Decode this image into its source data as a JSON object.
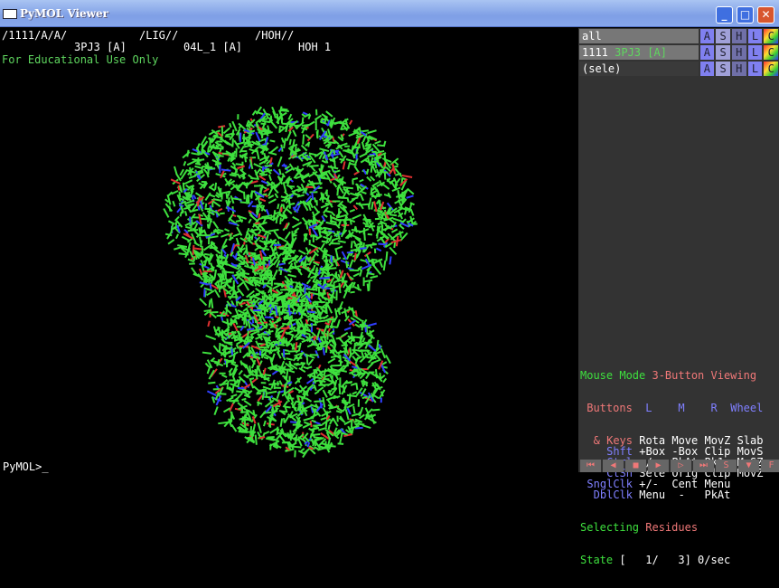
{
  "window": {
    "title": "PyMOL Viewer",
    "minimize": "_",
    "maximize": "□",
    "close": "✕"
  },
  "viewer": {
    "path1": "/1111/A/A/",
    "path2": "/LIG//",
    "path3": "/HOH//",
    "sel1": "3PJ3 [A]",
    "sel2": "04L_1 [A]",
    "sel3": "HOH 1",
    "notice": "For Educational Use Only",
    "command_prompt": "PyMOL>_"
  },
  "objects": [
    {
      "name": "all",
      "extra": ""
    },
    {
      "name": "1111 ",
      "extra": "3PJ3 [A]"
    },
    {
      "name": "(sele)",
      "extra": ""
    }
  ],
  "object_buttons": [
    "A",
    "S",
    "H",
    "L",
    "C"
  ],
  "mouse": {
    "mode_label": "Mouse Mode ",
    "mode_value": "3-Button Viewing",
    "buttons": "Buttons",
    "L": "L",
    "M": "M",
    "R": "R",
    "wheel": "Wheel",
    "rows": [
      {
        "key": "& Keys",
        "vals": "Rota Move MovZ Slab"
      },
      {
        "key": "Shft",
        "vals": "+Box -Box Clip MovS"
      },
      {
        "key": "Ctrl",
        "vals": "+/-  PkAt Pk1  MvSZ"
      },
      {
        "key": "CtSh",
        "vals": "Sele Orig Clip MovZ"
      },
      {
        "key": "SnglClk",
        "vals": "+/-  Cent Menu"
      },
      {
        "key": "DblClk",
        "vals": "Menu  -   PkAt"
      }
    ],
    "selecting": "Selecting ",
    "selecting_value": "Residues",
    "state_label": "State",
    "state_value": "[   1/   3] 0/sec"
  },
  "vcr": [
    "⏮",
    "◀",
    "■",
    "▶",
    "▷",
    "⏭",
    "S",
    "▼",
    "F"
  ]
}
